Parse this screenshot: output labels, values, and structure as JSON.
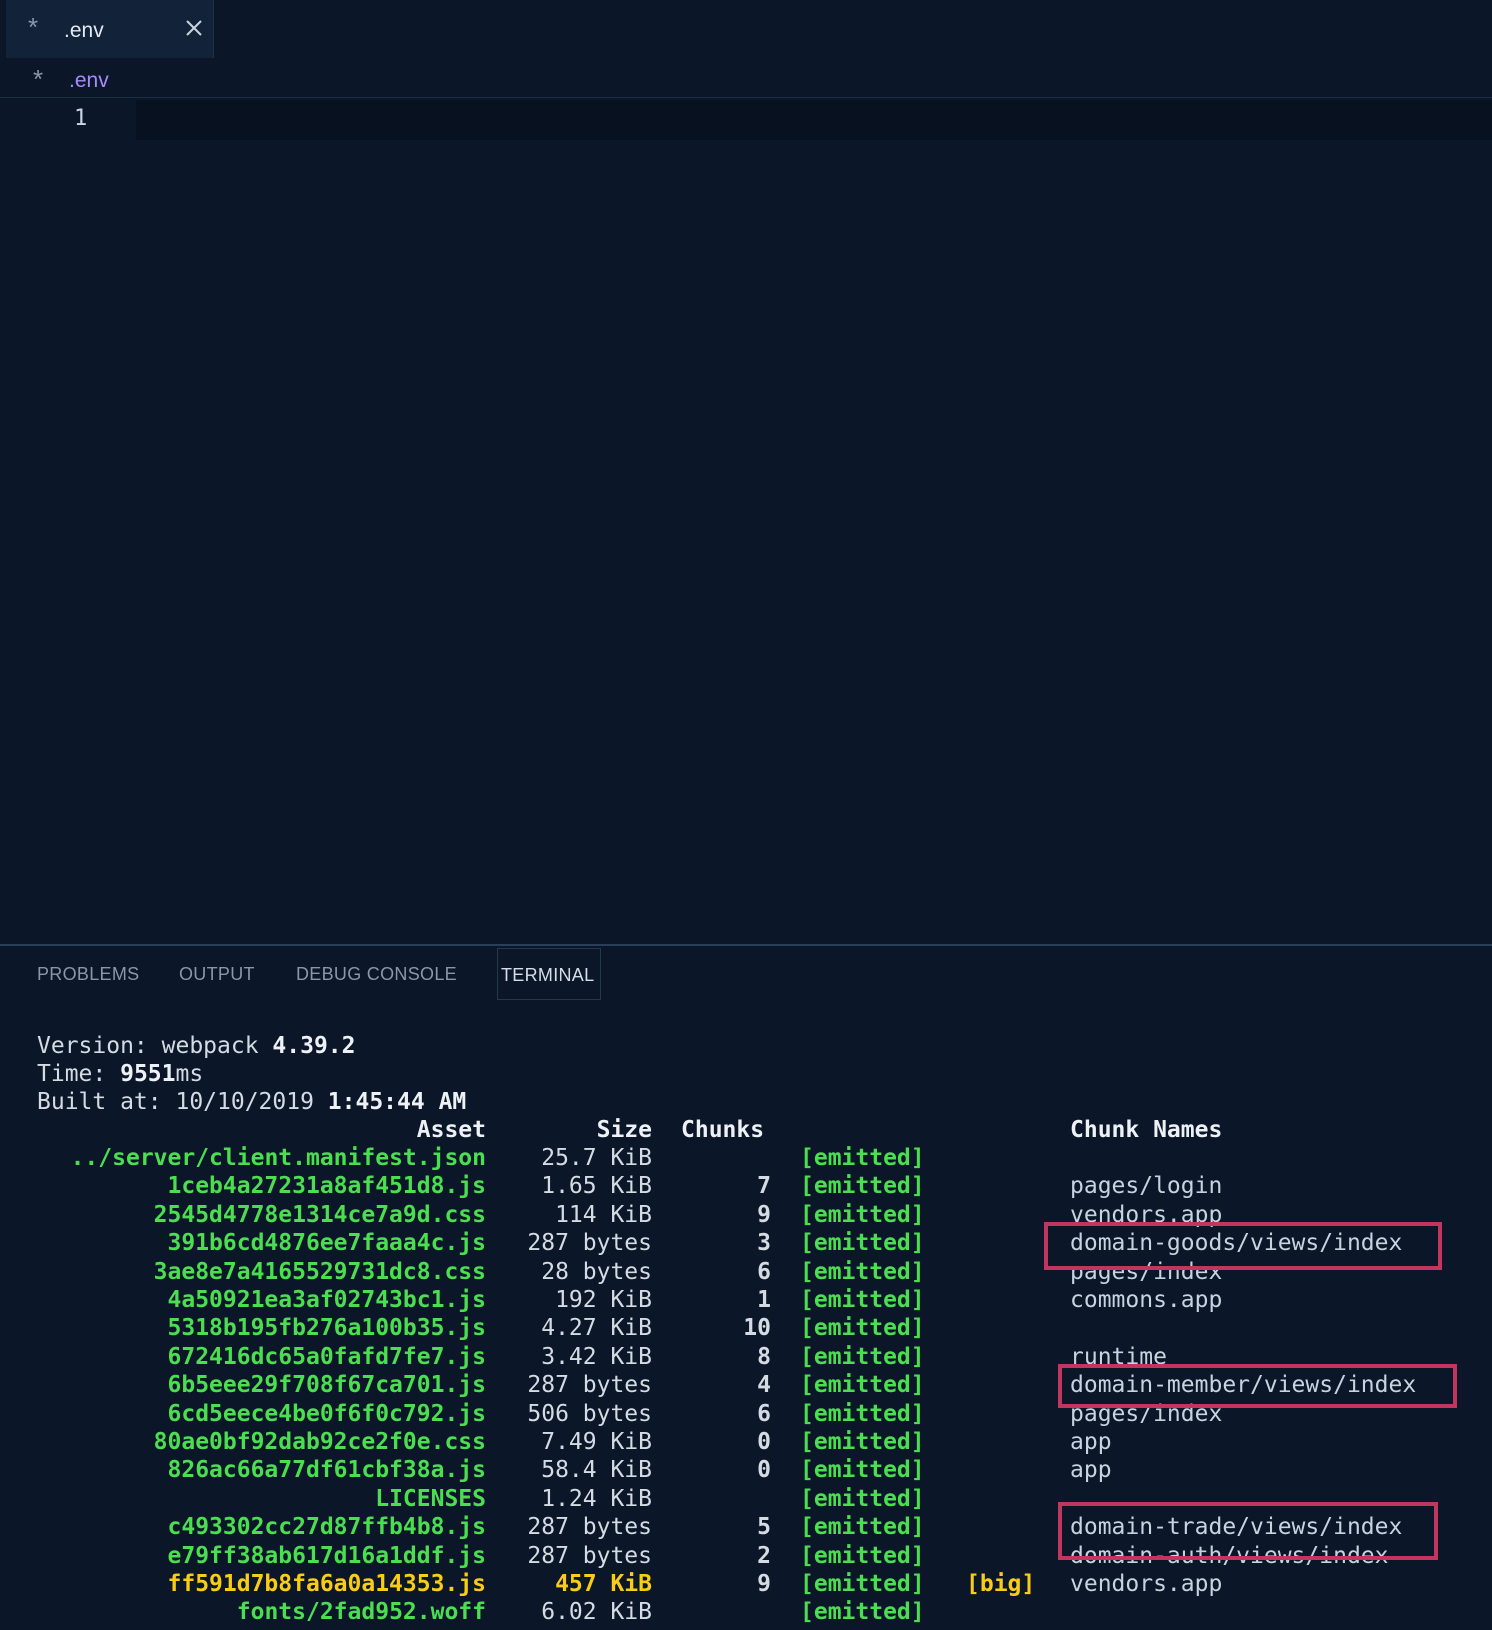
{
  "tab": {
    "label": ".env"
  },
  "breadcrumb": {
    "label": ".env"
  },
  "editor": {
    "line_number": "1"
  },
  "panel": {
    "tabs": [
      {
        "label": "PROBLEMS"
      },
      {
        "label": "OUTPUT"
      },
      {
        "label": "DEBUG CONSOLE"
      },
      {
        "label": "TERMINAL"
      }
    ]
  },
  "terminal": {
    "version_prefix": "Version: webpack ",
    "version": "4.39.2",
    "time_prefix": "Time: ",
    "time_value": "9551",
    "time_unit": "ms",
    "built_prefix": "Built at: 10/10/2019 ",
    "built_time": "1:45:44 AM",
    "headers": {
      "asset": "Asset",
      "size": "Size",
      "chunks": "Chunks",
      "names": "Chunk Names"
    },
    "rows": [
      {
        "asset": "../server/client.manifest.json",
        "size": "25.7 KiB",
        "chunks": "",
        "status": "[emitted]",
        "big": "",
        "names": ""
      },
      {
        "asset": "1ceb4a27231a8af451d8.js",
        "size": "1.65 KiB",
        "chunks": "7",
        "status": "[emitted]",
        "big": "",
        "names": "pages/login"
      },
      {
        "asset": "2545d4778e1314ce7a9d.css",
        "size": "114 KiB",
        "chunks": "9",
        "status": "[emitted]",
        "big": "",
        "names": "vendors.app"
      },
      {
        "asset": "391b6cd4876ee7faaa4c.js",
        "size": "287 bytes",
        "chunks": "3",
        "status": "[emitted]",
        "big": "",
        "names": "domain-goods/views/index"
      },
      {
        "asset": "3ae8e7a4165529731dc8.css",
        "size": "28 bytes",
        "chunks": "6",
        "status": "[emitted]",
        "big": "",
        "names": "pages/index"
      },
      {
        "asset": "4a50921ea3af02743bc1.js",
        "size": "192 KiB",
        "chunks": "1",
        "status": "[emitted]",
        "big": "",
        "names": "commons.app"
      },
      {
        "asset": "5318b195fb276a100b35.js",
        "size": "4.27 KiB",
        "chunks": "10",
        "status": "[emitted]",
        "big": "",
        "names": ""
      },
      {
        "asset": "672416dc65a0fafd7fe7.js",
        "size": "3.42 KiB",
        "chunks": "8",
        "status": "[emitted]",
        "big": "",
        "names": "runtime"
      },
      {
        "asset": "6b5eee29f708f67ca701.js",
        "size": "287 bytes",
        "chunks": "4",
        "status": "[emitted]",
        "big": "",
        "names": "domain-member/views/index"
      },
      {
        "asset": "6cd5eece4be0f6f0c792.js",
        "size": "506 bytes",
        "chunks": "6",
        "status": "[emitted]",
        "big": "",
        "names": "pages/index"
      },
      {
        "asset": "80ae0bf92dab92ce2f0e.css",
        "size": "7.49 KiB",
        "chunks": "0",
        "status": "[emitted]",
        "big": "",
        "names": "app"
      },
      {
        "asset": "826ac66a77df61cbf38a.js",
        "size": "58.4 KiB",
        "chunks": "0",
        "status": "[emitted]",
        "big": "",
        "names": "app"
      },
      {
        "asset": "LICENSES",
        "size": "1.24 KiB",
        "chunks": "",
        "status": "[emitted]",
        "big": "",
        "names": ""
      },
      {
        "asset": "c493302cc27d87ffb4b8.js",
        "size": "287 bytes",
        "chunks": "5",
        "status": "[emitted]",
        "big": "",
        "names": "domain-trade/views/index"
      },
      {
        "asset": "e79ff38ab617d16a1ddf.js",
        "size": "287 bytes",
        "chunks": "2",
        "status": "[emitted]",
        "big": "",
        "names": "domain-auth/views/index"
      },
      {
        "asset": "ff591d7b8fa6a0a14353.js",
        "size": "457 KiB",
        "chunks": "9",
        "status": "[emitted]",
        "big": "[big]",
        "names": "vendors.app"
      },
      {
        "asset": "fonts/2fad952.woff",
        "size": "6.02 KiB",
        "chunks": "",
        "status": "[emitted]",
        "big": "",
        "names": ""
      }
    ]
  },
  "colors": {
    "background": "#0b1728",
    "asset_green": "#4ade50",
    "big_yellow": "#facc15",
    "highlight_box": "#c2355f",
    "breadcrumb_purple": "#a78bfa"
  }
}
